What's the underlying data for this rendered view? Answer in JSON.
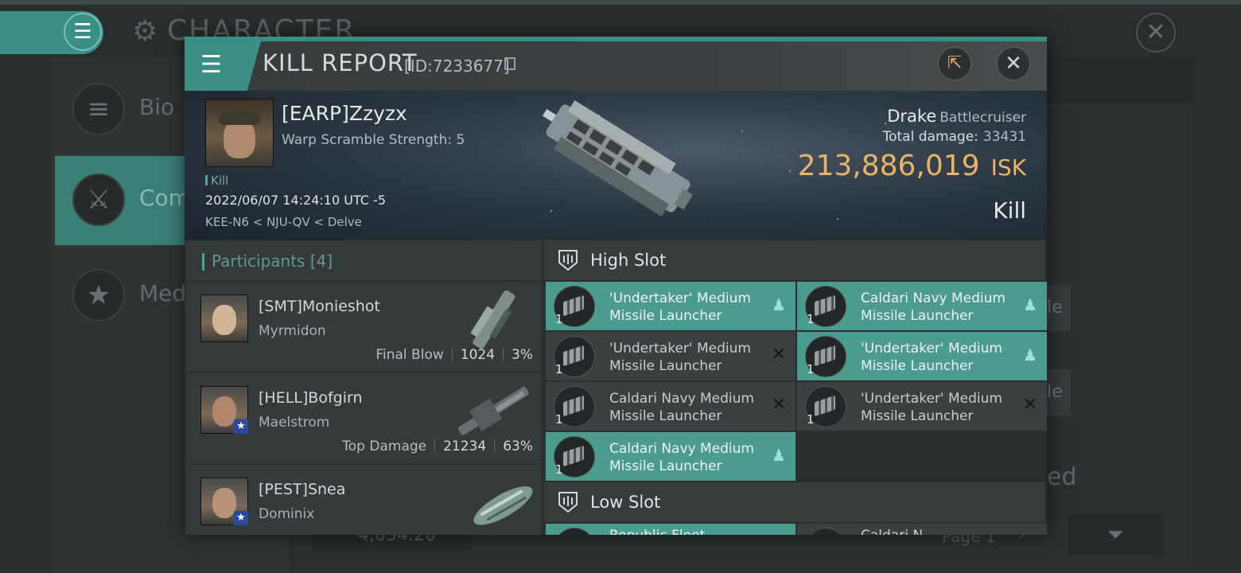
{
  "background": {
    "title": "CHARACTER",
    "side_items": [
      {
        "label": "Bio",
        "icon": "hamburger-icon"
      },
      {
        "label": "Com",
        "icon": "crossed-swords-icon"
      },
      {
        "label": "Meda",
        "icon": "star-icon"
      }
    ],
    "right_fragments": [
      "le",
      "le",
      "ed"
    ],
    "bottom_value": "4,034.20",
    "page_label": "Page 1"
  },
  "kill_report": {
    "title": "KILL REPORT",
    "id_label": "[ID:7233677]",
    "victim": {
      "name": "[EARP]Zzyzx",
      "subtitle": "Warp Scramble Strength: 5",
      "tag": "Kill",
      "datetime": "2022/06/07 14:24:10 UTC -5",
      "location": "KEE-N6 < NJU-QV < Delve"
    },
    "ship": {
      "name": "Drake",
      "class": "Battlecruiser",
      "total_damage_label": "Total damage:",
      "total_damage_value": "33431",
      "isk_value": "213,886,019",
      "isk_unit": "ISK",
      "result": "Kill"
    },
    "participants": {
      "header": "Participants [4]",
      "rows": [
        {
          "name": "[SMT]Monieshot",
          "ship": "Myrmidon",
          "role": "Final Blow",
          "damage": "1024",
          "percent": "3%",
          "badge": false
        },
        {
          "name": "[HELL]Bofgirn",
          "ship": "Maelstrom",
          "role": "Top Damage",
          "damage": "21234",
          "percent": "63%",
          "badge": true
        },
        {
          "name": "[PEST]Snea",
          "ship": "Dominix",
          "role": "",
          "damage": "",
          "percent": "",
          "badge": true
        }
      ]
    },
    "fitting": {
      "high_slot_label": "High Slot",
      "low_slot_label": "Low Slot",
      "high_modules": [
        {
          "qty": "1",
          "name": "'Undertaker' Medium Missile Launcher",
          "status": "pilot-icon",
          "highlight": true
        },
        {
          "qty": "1",
          "name": "Caldari Navy Medium Missile Launcher",
          "status": "pilot-icon",
          "highlight": true
        },
        {
          "qty": "1",
          "name": "'Undertaker' Medium Missile Launcher",
          "status": "destroyed-x-icon",
          "highlight": false
        },
        {
          "qty": "1",
          "name": "'Undertaker' Medium Missile Launcher",
          "status": "pilot-icon",
          "highlight": true
        },
        {
          "qty": "1",
          "name": "Caldari Navy Medium Missile Launcher",
          "status": "destroyed-x-icon",
          "highlight": false
        },
        {
          "qty": "1",
          "name": "'Undertaker' Medium Missile Launcher",
          "status": "destroyed-x-icon",
          "highlight": false
        },
        {
          "qty": "1",
          "name": "Caldari Navy Medium Missile Launcher",
          "status": "pilot-icon",
          "highlight": true
        }
      ],
      "low_modules_partial": [
        "Republic Fleet",
        "Caldari N"
      ]
    }
  },
  "colors": {
    "accent": "#3b8e83",
    "highlight_module": "#4c9b8f",
    "isk": "#eab365"
  }
}
